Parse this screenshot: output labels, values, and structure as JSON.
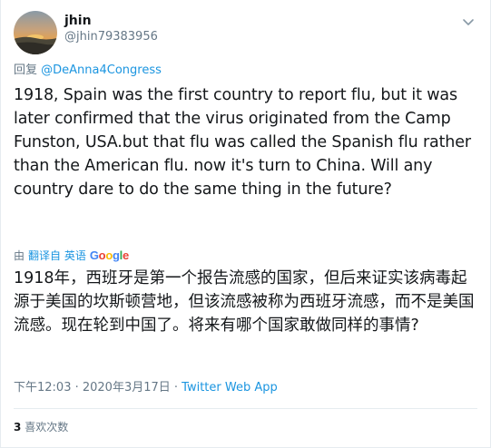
{
  "user": {
    "display_name": "jhin",
    "handle": "@jhin79383956",
    "avatar_icon": "sunset-landscape-avatar"
  },
  "reply": {
    "prefix": "回复",
    "mention": "@DeAnna4Congress"
  },
  "tweet": {
    "text": "1918, Spain was the first country to report flu, but it was later confirmed that the virus originated from the Camp Funston, USA.but that flu was called the Spanish flu rather than the American flu. now it's turn to China. Will any country dare to do the same thing in the future?"
  },
  "translation": {
    "prefix": "由",
    "link": "翻译自 英语",
    "provider": "Google",
    "text": "1918年，西班牙是第一个报告流感的国家，但后来证实该病毒起源于美国的坎斯顿营地，但该流感被称为西班牙流感，而不是美国流感。现在轮到中国了。将来有哪个国家敢做同样的事情?"
  },
  "meta": {
    "timestamp": "下午12:03 · 2020年3月17日 · ",
    "source": "Twitter Web App"
  },
  "stats": {
    "likes_count": "3",
    "likes_label": "喜欢次数"
  },
  "colors": {
    "link_blue": "#1b95e0",
    "secondary_text": "#657786",
    "google_blue": "#4285F4",
    "google_red": "#EA4335",
    "google_yellow": "#FBBC05",
    "google_green": "#34A853"
  }
}
